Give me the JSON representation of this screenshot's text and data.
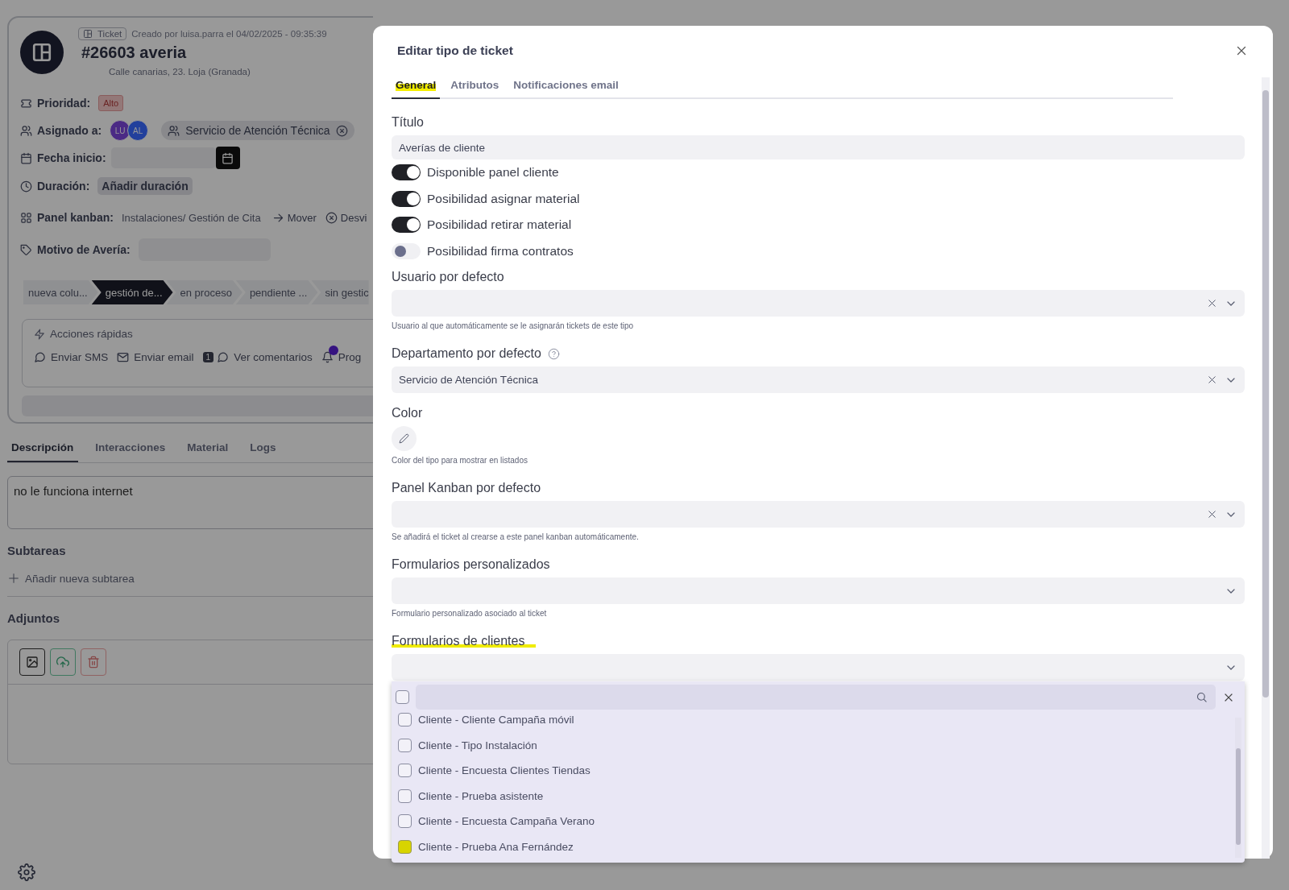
{
  "ticket": {
    "type_label": "Ticket",
    "created": "Creado por luisa.parra el 04/02/2025 - 09:35:39",
    "title": "#26603 averia",
    "address": "Calle canarias, 23. Loja (Granada)",
    "fields": [
      {
        "kind": "badge",
        "label": "Prioridad:",
        "value": "Alto"
      },
      {
        "kind": "assignees",
        "label": "Asignado a:",
        "avatars": [
          {
            "initials": "LU",
            "color": "#4b2a85"
          },
          {
            "initials": "AL",
            "color": "#22409c"
          }
        ],
        "value": "Servicio de Atención Técnica"
      },
      {
        "kind": "date",
        "label": "Fecha inicio:"
      },
      {
        "kind": "button",
        "label": "Duración:",
        "value": "Añadir duración"
      },
      {
        "kind": "kanban",
        "label": "Panel kanban:",
        "value": "Instalaciones/ Gestión de Cita",
        "actions": [
          {
            "kind": "move",
            "label": "Mover"
          },
          {
            "kind": "remove",
            "label": "Desvi"
          }
        ]
      },
      {
        "kind": "input",
        "label": "Motivo de Avería:"
      }
    ],
    "stages": [
      {
        "label": "nueva colu...",
        "selected": false
      },
      {
        "label": "gestión de...",
        "selected": true
      },
      {
        "label": "en proceso",
        "selected": false
      },
      {
        "label": "pendiente ...",
        "selected": false
      },
      {
        "label": "sin gestic",
        "selected": false
      }
    ],
    "quick_actions": {
      "title": "Acciones rápidas",
      "items": [
        {
          "kind": "sms",
          "label": "Enviar SMS"
        },
        {
          "kind": "email",
          "label": "Enviar email"
        },
        {
          "kind": "comments",
          "label": "Ver comentarios",
          "count": "1"
        },
        {
          "kind": "reminder",
          "label": "Prog",
          "notification": true
        }
      ]
    }
  },
  "detail_tabs": [
    {
      "label": "Descripción",
      "selected": true
    },
    {
      "label": "Interacciones",
      "selected": false
    },
    {
      "label": "Material",
      "selected": false
    },
    {
      "label": "Logs",
      "selected": false
    }
  ],
  "description": "no le funciona internet",
  "subtasks": {
    "title": "Subtareas",
    "add": "Añadir nueva subtarea"
  },
  "attachments": {
    "title": "Adjuntos"
  },
  "modal": {
    "title": "Editar tipo de ticket",
    "tabs": [
      {
        "label": "General",
        "selected": true,
        "highlighted": true
      },
      {
        "label": "Atributos",
        "selected": false,
        "highlighted": false
      },
      {
        "label": "Notificaciones email",
        "selected": false,
        "highlighted": false
      }
    ],
    "fields": [
      {
        "kind": "text",
        "label": "Título",
        "value": "Averías de cliente"
      },
      {
        "kind": "toggle",
        "label": "Disponible panel cliente",
        "on": true
      },
      {
        "kind": "toggle",
        "label": "Posibilidad asignar material",
        "on": true
      },
      {
        "kind": "toggle",
        "label": "Posibilidad retirar material",
        "on": true
      },
      {
        "kind": "toggle",
        "label": "Posibilidad firma contratos",
        "on": false
      },
      {
        "kind": "select",
        "label": "Usuario por defecto",
        "clearable": true,
        "hint": "Usuario al que automáticamente se le asignarán tickets de este tipo"
      },
      {
        "kind": "select",
        "label": "Departamento por defecto",
        "help": true,
        "clearable": true,
        "value": "Servicio de Atención Técnica"
      },
      {
        "kind": "color",
        "label": "Color",
        "hint": "Color del tipo para mostrar en listados"
      },
      {
        "kind": "select",
        "label": "Panel Kanban por defecto",
        "clearable": true,
        "hint": "Se añadirá el ticket al crearse a este panel kanban automáticamente."
      },
      {
        "kind": "select",
        "label": "Formularios personalizados",
        "clearable": false,
        "hint": "Formulario personalizado asociado al ticket"
      },
      {
        "kind": "multiselect",
        "label": "Formularios de clientes",
        "highlighted": true,
        "clearable": false,
        "open": true,
        "all_checked": false,
        "options": [
          {
            "label": "Cliente - Cliente Campaña móvil",
            "checked": false,
            "highlighted": false
          },
          {
            "label": "Cliente - Tipo Instalación",
            "checked": false,
            "highlighted": false
          },
          {
            "label": "Cliente - Encuesta Clientes Tiendas",
            "checked": false,
            "highlighted": false
          },
          {
            "label": "Cliente - Prueba asistente",
            "checked": false,
            "highlighted": false
          },
          {
            "label": "Cliente - Encuesta Campaña Verano",
            "checked": false,
            "highlighted": false
          },
          {
            "label": "Cliente - Prueba Ana Fernández",
            "checked": false,
            "highlighted": true
          }
        ]
      }
    ]
  }
}
